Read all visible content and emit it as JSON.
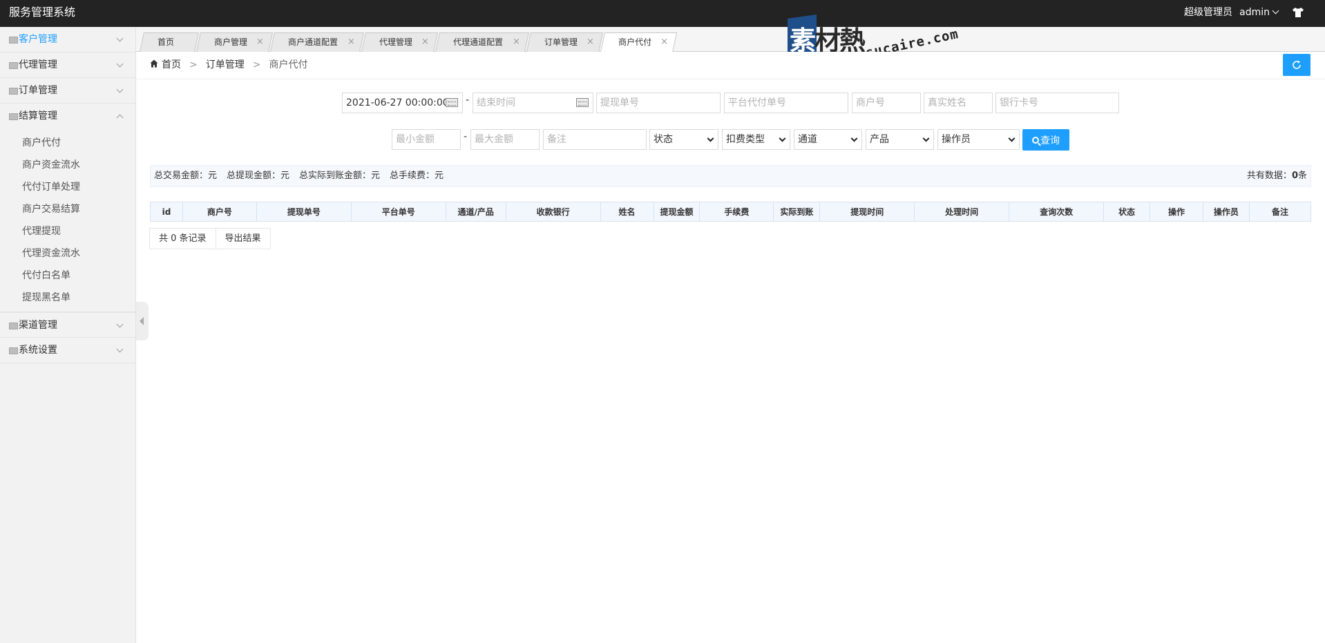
{
  "app": {
    "title": "服务管理系统"
  },
  "header": {
    "role": "超级管理员",
    "username": "admin"
  },
  "sidebar": {
    "menus": [
      {
        "label": "客户管理",
        "active": true,
        "expanded": false
      },
      {
        "label": "代理管理",
        "active": false,
        "expanded": false
      },
      {
        "label": "订单管理",
        "active": false,
        "expanded": false
      },
      {
        "label": "结算管理",
        "active": false,
        "expanded": true
      },
      {
        "label": "渠道管理",
        "active": false,
        "expanded": false
      },
      {
        "label": "系统设置",
        "active": false,
        "expanded": false
      }
    ],
    "sub_items": [
      "商户代付",
      "商户资金流水",
      "代付订单处理",
      "商户交易结算",
      "代理提现",
      "代理资金流水",
      "代付白名单",
      "提现黑名单"
    ]
  },
  "tabs": [
    {
      "label": "首页",
      "closable": false
    },
    {
      "label": "商户管理",
      "closable": true
    },
    {
      "label": "商户通道配置",
      "closable": true
    },
    {
      "label": "代理管理",
      "closable": true
    },
    {
      "label": "代理通道配置",
      "closable": true
    },
    {
      "label": "订单管理",
      "closable": true
    },
    {
      "label": "商户代付",
      "closable": true,
      "active": true
    }
  ],
  "tab_close_glyph": "×",
  "watermark": {
    "cn_1": "素",
    "cn_2": "材熱",
    "en": "sucaire.com"
  },
  "breadcrumb": {
    "home": "首页",
    "level1": "订单管理",
    "current": "商户代付",
    "separator": ">"
  },
  "filters": {
    "start_time": "2021-06-27 00:00:00",
    "end_time_placeholder": "结束时间",
    "withdraw_no_placeholder": "提现单号",
    "platform_no_placeholder": "平台代付单号",
    "merchant_no_placeholder": "商户号",
    "real_name_placeholder": "真实姓名",
    "bank_card_placeholder": "银行卡号",
    "min_amount_placeholder": "最小金额",
    "max_amount_placeholder": "最大金额",
    "remark_placeholder": "备注",
    "status": "状态",
    "fee_type": "扣费类型",
    "channel": "通道",
    "product": "产品",
    "operator": "操作员",
    "dash": "-",
    "search_label": "查询"
  },
  "summary": {
    "total_trade": "总交易金额：元",
    "total_withdraw": "总提现金额：元",
    "total_actual": "总实际到账金额：元",
    "total_fee": "总手续费：元",
    "count_label": "共有数据：",
    "count_value": "0",
    "count_unit": "条"
  },
  "table": {
    "columns": [
      "id",
      "商户号",
      "提现单号",
      "平台单号",
      "通道/产品",
      "收款银行",
      "姓名",
      "提现金额",
      "手续费",
      "实际到账",
      "提现时间",
      "处理时间",
      "查询次数",
      "状态",
      "操作",
      "操作员",
      "备注"
    ]
  },
  "pager": {
    "records": "共 0 条记录",
    "export": "导出结果"
  },
  "colors": {
    "accent": "#1e9fff",
    "topbar": "#232323",
    "sidebar_bg": "#f2f2f2"
  }
}
